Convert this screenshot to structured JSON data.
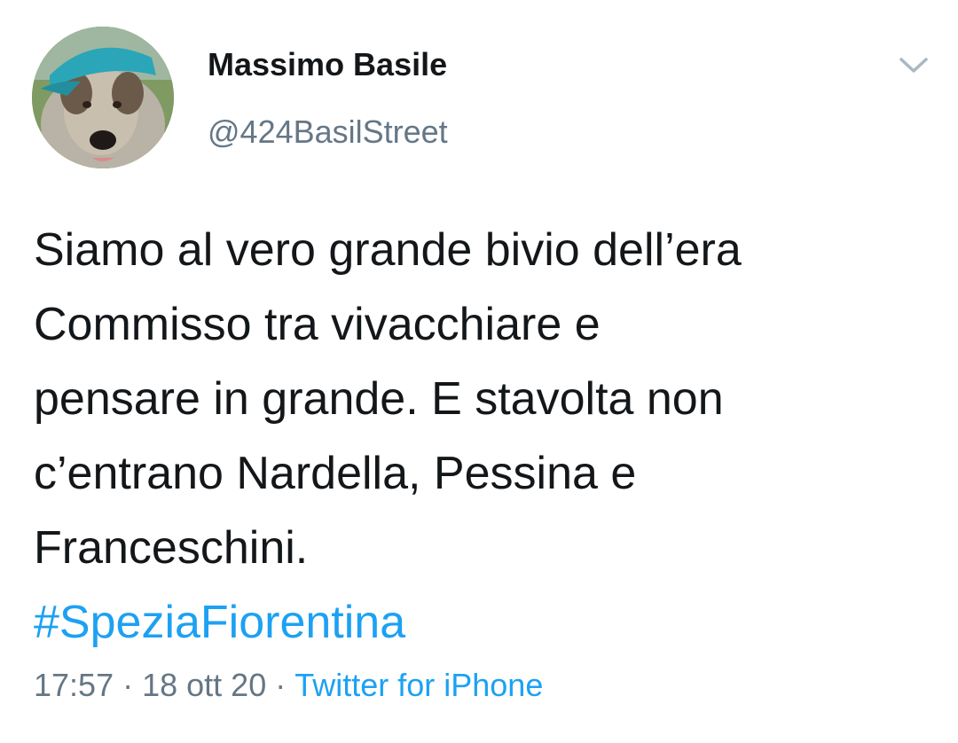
{
  "tweet": {
    "author": {
      "name": "Massimo Basile",
      "handle": "@424BasilStreet"
    },
    "text_lines": [
      "Siamo al vero grande bivio dell’era",
      "Commisso tra vivacchiare e",
      "pensare in grande. E stavolta non",
      "c’entrano Nardella, Pessina e",
      "Franceschini."
    ],
    "hashtag": "#SpeziaFiorentina",
    "time": "17:57",
    "separator": "·",
    "date": "18 ott 20",
    "source": "Twitter for iPhone",
    "icons": {
      "menu": "chevron-down-icon",
      "avatar": "dog-with-cap-avatar"
    },
    "colors": {
      "link": "#1da1f2",
      "secondary_text": "#657786",
      "primary_text": "#14171a"
    }
  }
}
